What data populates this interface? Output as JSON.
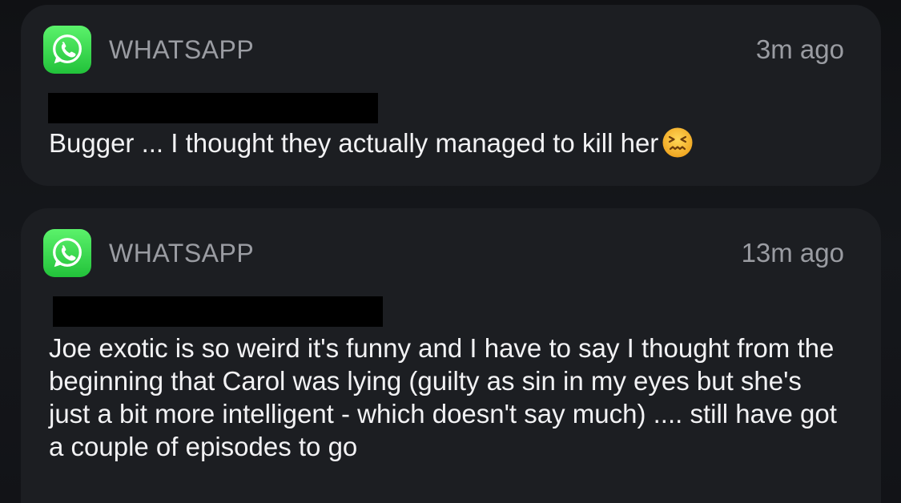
{
  "notifications": [
    {
      "app_name": "WHATSAPP",
      "app_icon": "whatsapp-icon",
      "time": "3m ago",
      "message": "Bugger ... I thought they actually managed to kill her",
      "emoji": "confounded-face-emoji"
    },
    {
      "app_name": "WHATSAPP",
      "app_icon": "whatsapp-icon",
      "time": "13m ago",
      "message": "Joe exotic is so weird it's funny and I have to say I thought from the beginning that Carol was lying (guilty as sin in my eyes but she's just a bit more intelligent - which doesn't say much) .... still have got a couple of episodes to go"
    }
  ],
  "colors": {
    "background": "#121317",
    "card": "#1c1e22",
    "whatsapp_green": "#2fd24a",
    "secondary_text": "#9a9ca2",
    "primary_text": "#f2f2f4",
    "redaction": "#000000"
  }
}
